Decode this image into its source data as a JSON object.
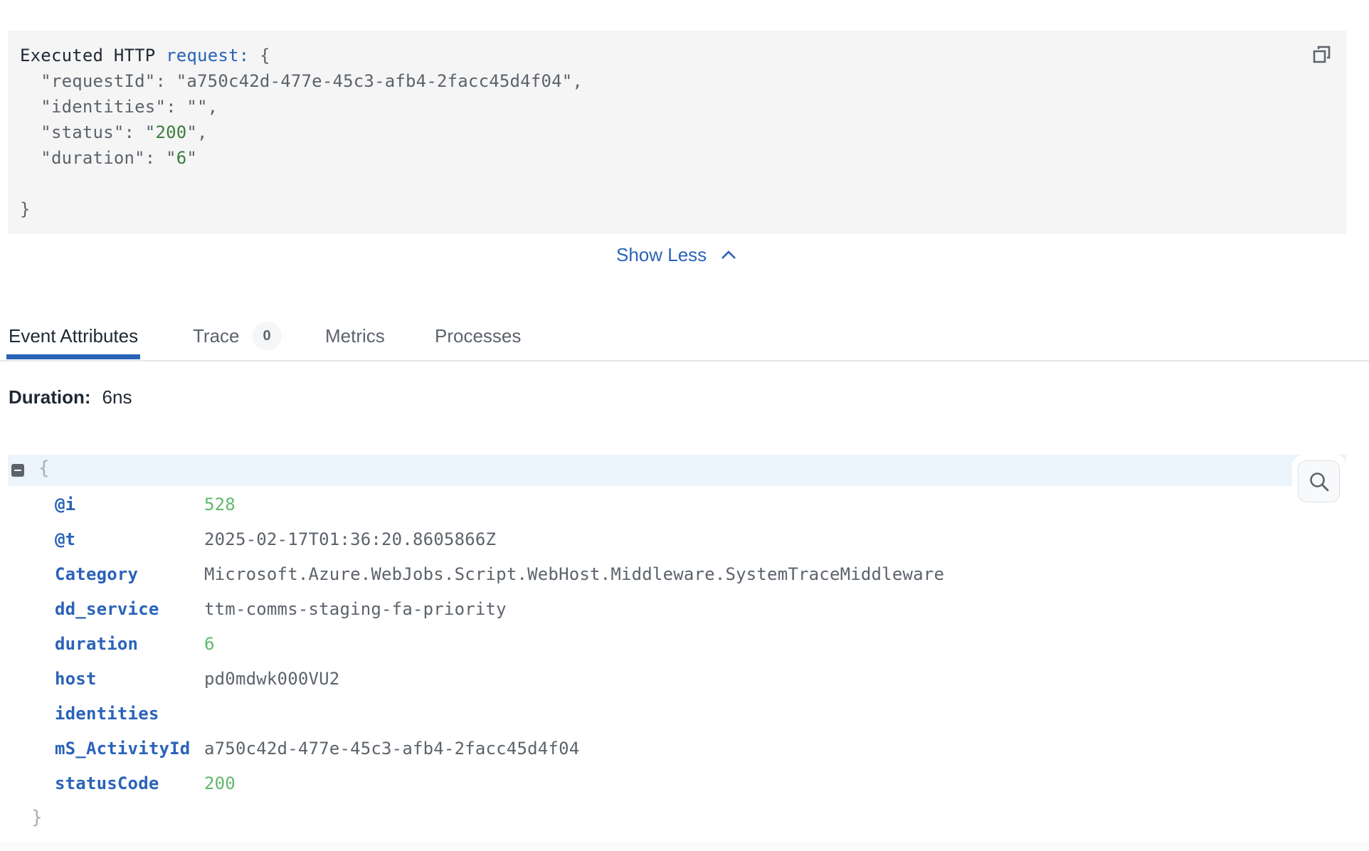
{
  "log_message": {
    "lines": [
      [
        {
          "t": "Executed HTTP ",
          "c": "dark"
        },
        {
          "t": "request:",
          "c": "blue"
        },
        {
          "t": " {",
          "c": "grey"
        }
      ],
      [
        {
          "t": "  \"requestId\": \"a750c42d-477e-45c3-afb4-2facc45d4f04\",",
          "c": "grey"
        }
      ],
      [
        {
          "t": "  \"identities\": \"\",",
          "c": "grey"
        }
      ],
      [
        {
          "t": "  \"status\": \"",
          "c": "grey"
        },
        {
          "t": "200",
          "c": "green"
        },
        {
          "t": "\",",
          "c": "grey"
        }
      ],
      [
        {
          "t": "  \"duration\": \"",
          "c": "grey"
        },
        {
          "t": "6",
          "c": "green"
        },
        {
          "t": "\"",
          "c": "grey"
        }
      ],
      [
        {
          "t": "",
          "c": "grey"
        }
      ],
      [
        {
          "t": "}",
          "c": "grey"
        }
      ]
    ],
    "copy_icon": "copy-icon"
  },
  "show_less": {
    "label": "Show Less",
    "icon": "chevron-up-icon"
  },
  "tabs": [
    {
      "label": "Event Attributes",
      "active": true
    },
    {
      "label": "Trace",
      "badge": "0",
      "active": false
    },
    {
      "label": "Metrics",
      "active": false
    },
    {
      "label": "Processes",
      "active": false
    }
  ],
  "duration": {
    "label": "Duration:",
    "value": "6ns"
  },
  "attributes": {
    "open_brace": "{",
    "close_brace": "}",
    "search_icon": "search-icon",
    "rows": [
      {
        "key": "@i",
        "value": "528",
        "type": "number"
      },
      {
        "key": "@t",
        "value": "2025-02-17T01:36:20.8605866Z",
        "type": "string"
      },
      {
        "key": "Category",
        "value": "Microsoft.Azure.WebJobs.Script.WebHost.Middleware.SystemTraceMiddleware",
        "type": "string"
      },
      {
        "key": "dd_service",
        "value": "ttm-comms-staging-fa-priority",
        "type": "string"
      },
      {
        "key": "duration",
        "value": "6",
        "type": "number"
      },
      {
        "key": "host",
        "value": "pd0mdwk000VU2",
        "type": "string"
      },
      {
        "key": "identities",
        "value": "",
        "type": "string"
      },
      {
        "key": "mS_ActivityId",
        "value": "a750c42d-477e-45c3-afb4-2facc45d4f04",
        "type": "string"
      },
      {
        "key": "statusCode",
        "value": "200",
        "type": "number"
      }
    ]
  },
  "colors": {
    "accent": "#2a63b8",
    "number": "#5fb96a",
    "code_number": "#3a7d3e",
    "text_muted": "#5c636b",
    "text_dark": "#1f2933",
    "code_bg": "#f5f5f5",
    "highlight_bg": "#ecf4fc"
  }
}
